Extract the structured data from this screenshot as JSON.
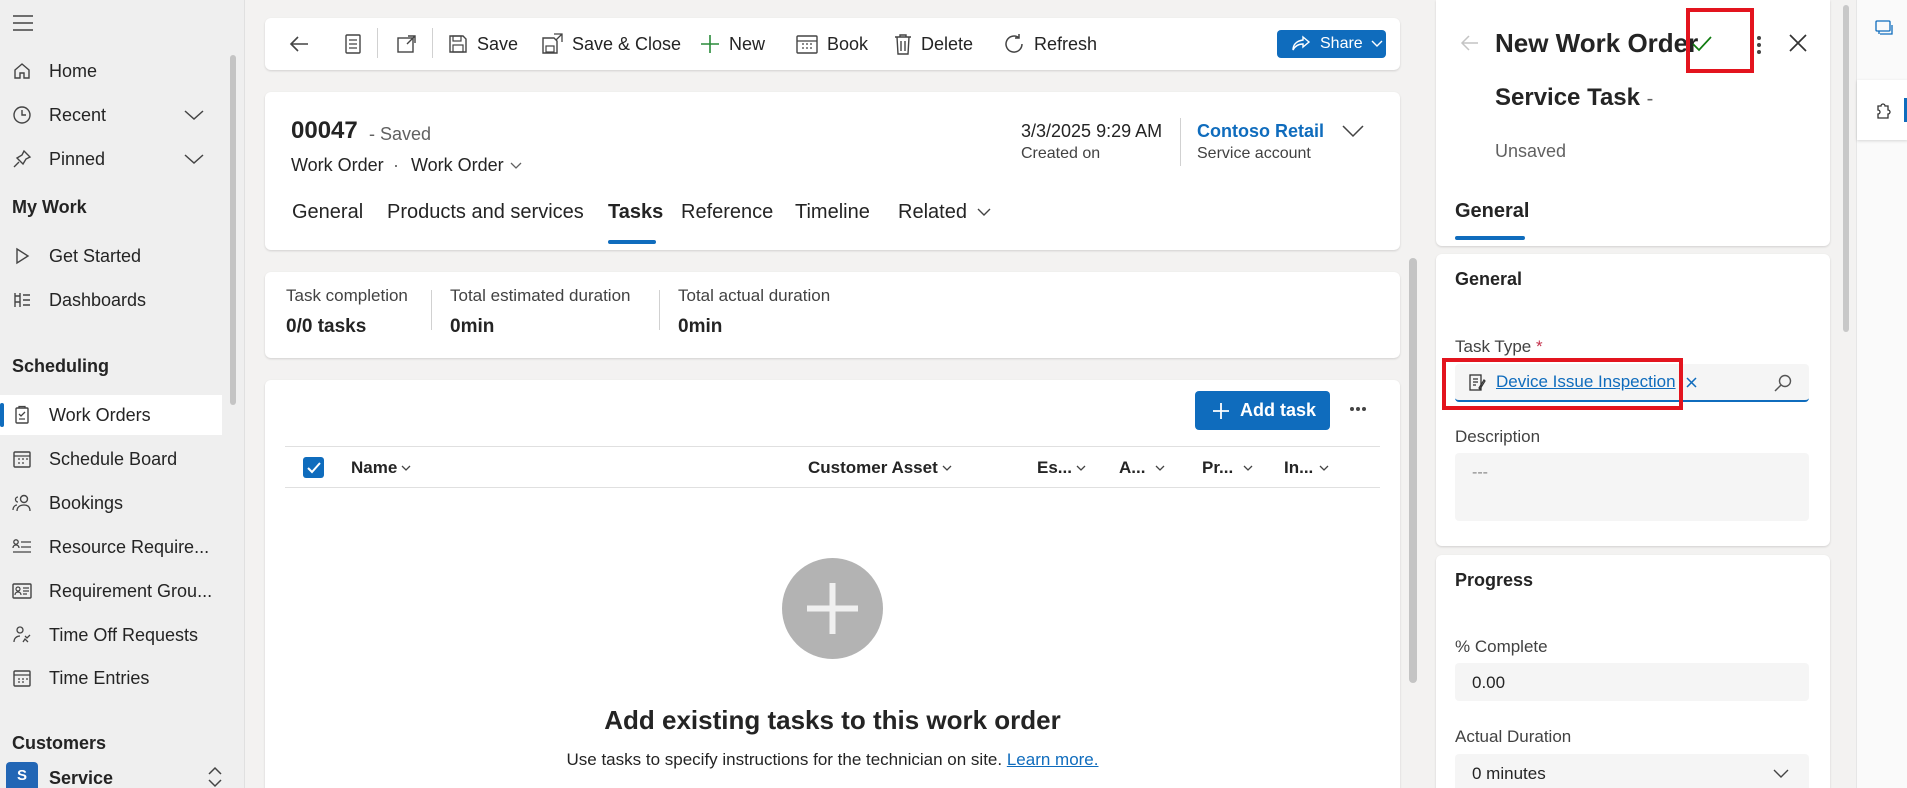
{
  "sidebar": {
    "items": [
      {
        "label": "Home",
        "icon": "home-icon"
      },
      {
        "label": "Recent",
        "icon": "clock-icon"
      },
      {
        "label": "Pinned",
        "icon": "pin-icon"
      }
    ],
    "my_work_heading": "My Work",
    "my_work": [
      {
        "label": "Get Started",
        "icon": "play-icon"
      },
      {
        "label": "Dashboards",
        "icon": "dashboard-icon"
      }
    ],
    "scheduling_heading": "Scheduling",
    "scheduling": [
      {
        "label": "Work Orders",
        "icon": "clipboard-icon"
      },
      {
        "label": "Schedule Board",
        "icon": "calendar-icon"
      },
      {
        "label": "Bookings",
        "icon": "people-icon"
      },
      {
        "label": "Resource Require...",
        "icon": "list-person-icon"
      },
      {
        "label": "Requirement Grou...",
        "icon": "group-card-icon"
      },
      {
        "label": "Time Off Requests",
        "icon": "person-time-icon"
      },
      {
        "label": "Time Entries",
        "icon": "calendar-clock-icon"
      }
    ],
    "customers_heading": "Customers",
    "area": {
      "badge": "S",
      "label": "Service"
    }
  },
  "toolbar": {
    "save": "Save",
    "save_close": "Save & Close",
    "new": "New",
    "book": "Book",
    "delete": "Delete",
    "refresh": "Refresh",
    "share": "Share"
  },
  "header": {
    "number": "00047",
    "status": "- Saved",
    "entity": "Work Order",
    "separator": "·",
    "form": "Work Order",
    "created_value": "3/3/2025 9:29 AM",
    "created_label": "Created on",
    "account_value": "Contoso Retail",
    "account_label": "Service account"
  },
  "tabs": [
    "General",
    "Products and services",
    "Tasks",
    "Reference",
    "Timeline",
    "Related"
  ],
  "active_tab": "Tasks",
  "metrics": [
    {
      "label": "Task completion",
      "value": "0/0 tasks"
    },
    {
      "label": "Total estimated duration",
      "value": "0min"
    },
    {
      "label": "Total actual duration",
      "value": "0min"
    }
  ],
  "grid": {
    "add_task": "Add task",
    "columns": [
      "Name",
      "Customer Asset",
      "Es...",
      "A...",
      "Pr...",
      "In..."
    ],
    "empty_title": "Add existing tasks to this work order",
    "empty_desc": "Use tasks to specify instructions for the technician on site.",
    "learn_more": "Learn more."
  },
  "panel": {
    "title": "New Work Order",
    "subtitle": "Service Task",
    "subtitle_suffix": "-",
    "status": "Unsaved",
    "tab": "General",
    "section_general": "General",
    "task_type_label": "Task Type",
    "required_mark": "*",
    "task_type_value": "Device Issue Inspection",
    "description_label": "Description",
    "description_placeholder": "---",
    "section_progress": "Progress",
    "complete_label": "% Complete",
    "complete_value": "0.00",
    "actual_duration_label": "Actual Duration",
    "actual_duration_value": "0 minutes"
  },
  "colors": {
    "accent": "#0f6cbd",
    "highlight": "#e3141e",
    "confirm": "#107c10"
  }
}
